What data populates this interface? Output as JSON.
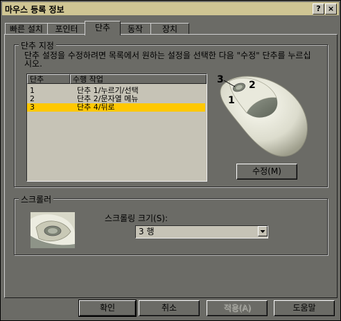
{
  "window": {
    "title": "마우스 등록 정보"
  },
  "title_buttons": {
    "help": "?",
    "close": "×"
  },
  "tabs": [
    {
      "label": "빠른 설치"
    },
    {
      "label": "포인터"
    },
    {
      "label": "단추"
    },
    {
      "label": "동작"
    },
    {
      "label": "장치"
    }
  ],
  "active_tab": "단추",
  "button_group": {
    "label": "단추 지정",
    "description": "단추 설정을 수정하려면 목록에서 원하는 설정을 선택한 다음 \"수정\" 단추를 누르십시오.",
    "list": {
      "headers": [
        "단추",
        "수행 작업"
      ],
      "rows": [
        {
          "button": "1",
          "action": "단추 1/누르기/선택"
        },
        {
          "button": "2",
          "action": "단추 2/문자열 메뉴"
        },
        {
          "button": "3",
          "action": "단추 4/뒤로"
        }
      ],
      "selected_index": 2
    },
    "mouse_callouts": [
      "3",
      "2",
      "1"
    ],
    "modify_button": "수정(M)"
  },
  "scroll_group": {
    "label": "스크롤러",
    "scroll_size_label": "스크롤링 크기(S):",
    "scroll_size_value": "3 행"
  },
  "footer": {
    "ok": "확인",
    "cancel": "취소",
    "apply": "적용(A)",
    "help": "도움말"
  },
  "colors": {
    "background": "#6b6b66",
    "titlebar": "#cfc593",
    "selection": "#ffc800",
    "list_bg": "#c6c3b6"
  }
}
